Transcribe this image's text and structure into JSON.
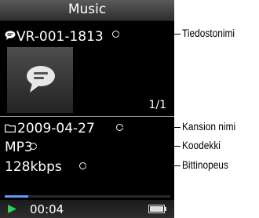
{
  "screen": {
    "title": "Music",
    "file_name": "VR-001-1813",
    "counter": "1/1",
    "folder_date": "2009-04-27",
    "codec": "MP3",
    "bitrate": "128kbps",
    "time": "00:04",
    "progress": 0.14
  },
  "callouts": {
    "file_name_label": "Tiedostonimi",
    "folder_label": "Kansion nimi",
    "codec_label": "Koodekki",
    "bitrate_label": "Bittinopeus"
  },
  "colors": {
    "progress_fill": "#5c9bff",
    "play_icon": "#2fd05a"
  },
  "icons": [
    "speech-bubble-icon",
    "folder-icon",
    "play-icon",
    "battery-icon"
  ]
}
